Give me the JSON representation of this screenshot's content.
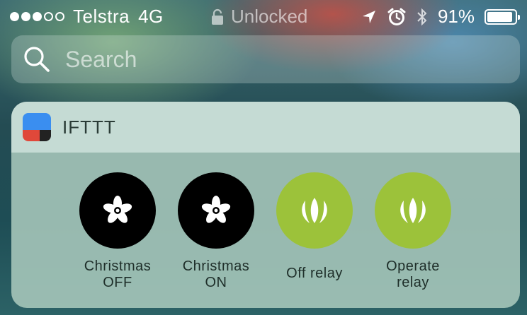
{
  "status_bar": {
    "signal": [
      "full",
      "full",
      "full",
      "empty",
      "empty"
    ],
    "carrier": "Telstra",
    "network": "4G",
    "lock_text": "Unlocked",
    "battery_percent": "91%",
    "battery_level": 0.91,
    "icons": [
      "lock-icon",
      "location-arrow-icon",
      "alarm-icon",
      "bluetooth-icon",
      "battery-icon"
    ]
  },
  "search": {
    "placeholder": "Search"
  },
  "widget": {
    "title": "IFTTT",
    "app_icon": "ifttt-app-icon",
    "actions": [
      {
        "line1": "Christmas",
        "line2": "OFF",
        "icon": "adafruit-flower-icon",
        "color": "#000000"
      },
      {
        "line1": "Christmas",
        "line2": "ON",
        "icon": "adafruit-flower-icon",
        "color": "#000000"
      },
      {
        "line1": "Off relay",
        "line2": "",
        "icon": "particle-leaf-icon",
        "color": "#9cc23a"
      },
      {
        "line1": "Operate",
        "line2": "relay",
        "icon": "particle-leaf-icon",
        "color": "#9cc23a"
      }
    ]
  }
}
